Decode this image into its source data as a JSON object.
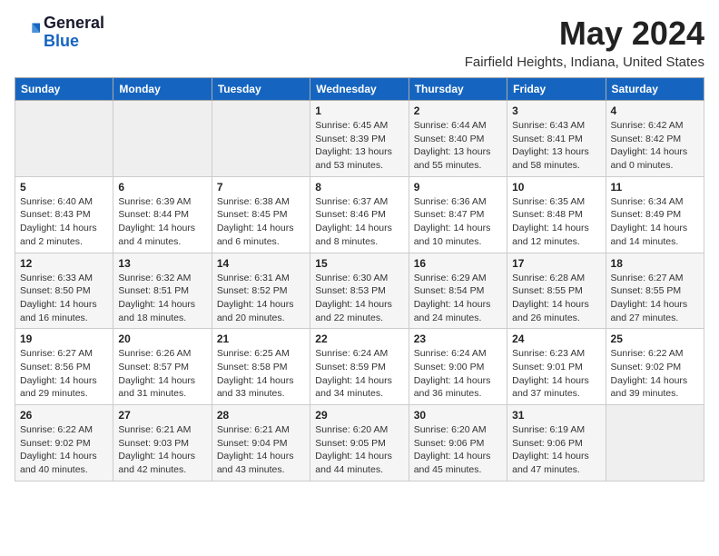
{
  "header": {
    "logo": {
      "line1": "General",
      "line2": "Blue"
    },
    "month": "May 2024",
    "location": "Fairfield Heights, Indiana, United States"
  },
  "weekdays": [
    "Sunday",
    "Monday",
    "Tuesday",
    "Wednesday",
    "Thursday",
    "Friday",
    "Saturday"
  ],
  "weeks": [
    [
      {
        "day": "",
        "info": ""
      },
      {
        "day": "",
        "info": ""
      },
      {
        "day": "",
        "info": ""
      },
      {
        "day": "1",
        "info": "Sunrise: 6:45 AM\nSunset: 8:39 PM\nDaylight: 13 hours\nand 53 minutes."
      },
      {
        "day": "2",
        "info": "Sunrise: 6:44 AM\nSunset: 8:40 PM\nDaylight: 13 hours\nand 55 minutes."
      },
      {
        "day": "3",
        "info": "Sunrise: 6:43 AM\nSunset: 8:41 PM\nDaylight: 13 hours\nand 58 minutes."
      },
      {
        "day": "4",
        "info": "Sunrise: 6:42 AM\nSunset: 8:42 PM\nDaylight: 14 hours\nand 0 minutes."
      }
    ],
    [
      {
        "day": "5",
        "info": "Sunrise: 6:40 AM\nSunset: 8:43 PM\nDaylight: 14 hours\nand 2 minutes."
      },
      {
        "day": "6",
        "info": "Sunrise: 6:39 AM\nSunset: 8:44 PM\nDaylight: 14 hours\nand 4 minutes."
      },
      {
        "day": "7",
        "info": "Sunrise: 6:38 AM\nSunset: 8:45 PM\nDaylight: 14 hours\nand 6 minutes."
      },
      {
        "day": "8",
        "info": "Sunrise: 6:37 AM\nSunset: 8:46 PM\nDaylight: 14 hours\nand 8 minutes."
      },
      {
        "day": "9",
        "info": "Sunrise: 6:36 AM\nSunset: 8:47 PM\nDaylight: 14 hours\nand 10 minutes."
      },
      {
        "day": "10",
        "info": "Sunrise: 6:35 AM\nSunset: 8:48 PM\nDaylight: 14 hours\nand 12 minutes."
      },
      {
        "day": "11",
        "info": "Sunrise: 6:34 AM\nSunset: 8:49 PM\nDaylight: 14 hours\nand 14 minutes."
      }
    ],
    [
      {
        "day": "12",
        "info": "Sunrise: 6:33 AM\nSunset: 8:50 PM\nDaylight: 14 hours\nand 16 minutes."
      },
      {
        "day": "13",
        "info": "Sunrise: 6:32 AM\nSunset: 8:51 PM\nDaylight: 14 hours\nand 18 minutes."
      },
      {
        "day": "14",
        "info": "Sunrise: 6:31 AM\nSunset: 8:52 PM\nDaylight: 14 hours\nand 20 minutes."
      },
      {
        "day": "15",
        "info": "Sunrise: 6:30 AM\nSunset: 8:53 PM\nDaylight: 14 hours\nand 22 minutes."
      },
      {
        "day": "16",
        "info": "Sunrise: 6:29 AM\nSunset: 8:54 PM\nDaylight: 14 hours\nand 24 minutes."
      },
      {
        "day": "17",
        "info": "Sunrise: 6:28 AM\nSunset: 8:55 PM\nDaylight: 14 hours\nand 26 minutes."
      },
      {
        "day": "18",
        "info": "Sunrise: 6:27 AM\nSunset: 8:55 PM\nDaylight: 14 hours\nand 27 minutes."
      }
    ],
    [
      {
        "day": "19",
        "info": "Sunrise: 6:27 AM\nSunset: 8:56 PM\nDaylight: 14 hours\nand 29 minutes."
      },
      {
        "day": "20",
        "info": "Sunrise: 6:26 AM\nSunset: 8:57 PM\nDaylight: 14 hours\nand 31 minutes."
      },
      {
        "day": "21",
        "info": "Sunrise: 6:25 AM\nSunset: 8:58 PM\nDaylight: 14 hours\nand 33 minutes."
      },
      {
        "day": "22",
        "info": "Sunrise: 6:24 AM\nSunset: 8:59 PM\nDaylight: 14 hours\nand 34 minutes."
      },
      {
        "day": "23",
        "info": "Sunrise: 6:24 AM\nSunset: 9:00 PM\nDaylight: 14 hours\nand 36 minutes."
      },
      {
        "day": "24",
        "info": "Sunrise: 6:23 AM\nSunset: 9:01 PM\nDaylight: 14 hours\nand 37 minutes."
      },
      {
        "day": "25",
        "info": "Sunrise: 6:22 AM\nSunset: 9:02 PM\nDaylight: 14 hours\nand 39 minutes."
      }
    ],
    [
      {
        "day": "26",
        "info": "Sunrise: 6:22 AM\nSunset: 9:02 PM\nDaylight: 14 hours\nand 40 minutes."
      },
      {
        "day": "27",
        "info": "Sunrise: 6:21 AM\nSunset: 9:03 PM\nDaylight: 14 hours\nand 42 minutes."
      },
      {
        "day": "28",
        "info": "Sunrise: 6:21 AM\nSunset: 9:04 PM\nDaylight: 14 hours\nand 43 minutes."
      },
      {
        "day": "29",
        "info": "Sunrise: 6:20 AM\nSunset: 9:05 PM\nDaylight: 14 hours\nand 44 minutes."
      },
      {
        "day": "30",
        "info": "Sunrise: 6:20 AM\nSunset: 9:06 PM\nDaylight: 14 hours\nand 45 minutes."
      },
      {
        "day": "31",
        "info": "Sunrise: 6:19 AM\nSunset: 9:06 PM\nDaylight: 14 hours\nand 47 minutes."
      },
      {
        "day": "",
        "info": ""
      }
    ]
  ]
}
